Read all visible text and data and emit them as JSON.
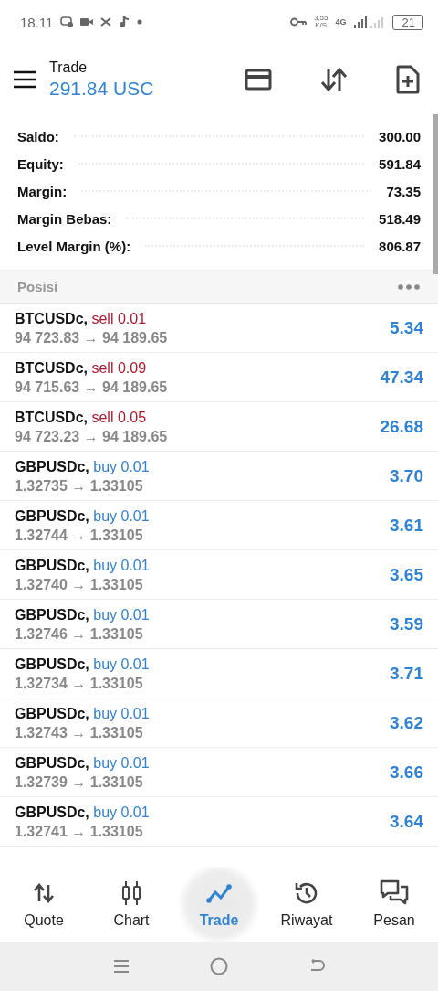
{
  "status_bar": {
    "time": "18.11",
    "speed": "3,55",
    "speed_unit": "K/S",
    "network": "4G",
    "battery": "21"
  },
  "header": {
    "title": "Trade",
    "balance": "291.84 USC"
  },
  "summary": [
    {
      "label": "Saldo:",
      "value": "300.00"
    },
    {
      "label": "Equity:",
      "value": "591.84"
    },
    {
      "label": "Margin:",
      "value": "73.35"
    },
    {
      "label": "Margin Bebas:",
      "value": "518.49"
    },
    {
      "label": "Level Margin (%):",
      "value": "806.87"
    }
  ],
  "positions_title": "Posisi",
  "positions": [
    {
      "symbol": "BTCUSDc,",
      "kind": "sell",
      "order": "sell 0.01",
      "prices": "94 723.83 → 94 189.65",
      "profit": "5.34"
    },
    {
      "symbol": "BTCUSDc,",
      "kind": "sell",
      "order": "sell 0.09",
      "prices": "94 715.63 → 94 189.65",
      "profit": "47.34"
    },
    {
      "symbol": "BTCUSDc,",
      "kind": "sell",
      "order": "sell 0.05",
      "prices": "94 723.23 → 94 189.65",
      "profit": "26.68"
    },
    {
      "symbol": "GBPUSDc,",
      "kind": "buy",
      "order": "buy 0.01",
      "prices": "1.32735 → 1.33105",
      "profit": "3.70"
    },
    {
      "symbol": "GBPUSDc,",
      "kind": "buy",
      "order": "buy 0.01",
      "prices": "1.32744 → 1.33105",
      "profit": "3.61"
    },
    {
      "symbol": "GBPUSDc,",
      "kind": "buy",
      "order": "buy 0.01",
      "prices": "1.32740 → 1.33105",
      "profit": "3.65"
    },
    {
      "symbol": "GBPUSDc,",
      "kind": "buy",
      "order": "buy 0.01",
      "prices": "1.32746 → 1.33105",
      "profit": "3.59"
    },
    {
      "symbol": "GBPUSDc,",
      "kind": "buy",
      "order": "buy 0.01",
      "prices": "1.32734 → 1.33105",
      "profit": "3.71"
    },
    {
      "symbol": "GBPUSDc,",
      "kind": "buy",
      "order": "buy 0.01",
      "prices": "1.32743 → 1.33105",
      "profit": "3.62"
    },
    {
      "symbol": "GBPUSDc,",
      "kind": "buy",
      "order": "buy 0.01",
      "prices": "1.32739 → 1.33105",
      "profit": "3.66"
    },
    {
      "symbol": "GBPUSDc,",
      "kind": "buy",
      "order": "buy 0.01",
      "prices": "1.32741 → 1.33105",
      "profit": "3.64"
    }
  ],
  "nav": [
    {
      "label": "Quote",
      "selected": false
    },
    {
      "label": "Chart",
      "selected": false
    },
    {
      "label": "Trade",
      "selected": true
    },
    {
      "label": "Riwayat",
      "selected": false
    },
    {
      "label": "Pesan",
      "selected": false
    }
  ]
}
